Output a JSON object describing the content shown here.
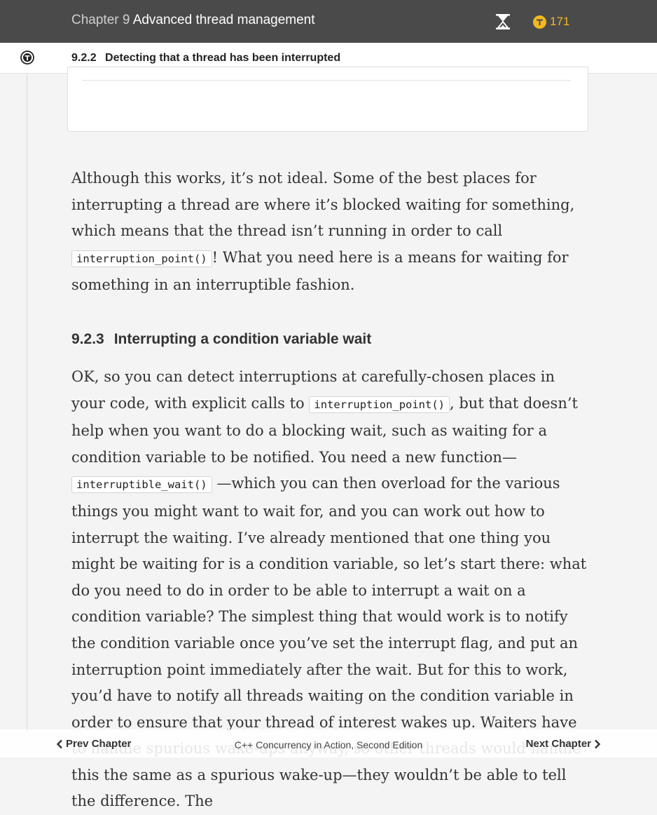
{
  "header": {
    "chapter_num": "Chapter 9",
    "chapter_title": "Advanced thread management",
    "token_count": "171"
  },
  "subheader": {
    "section_num": "9.2.2",
    "section_title": "Detecting that a thread has been interrupted"
  },
  "content": {
    "p1": {
      "t1": "Although this works, it’s not ideal. Some of the best places for interrupting a thread are where it’s blocked waiting for something, which means that the thread isn’t running in order to call ",
      "c1": "interruption_point()",
      "t2": "! What you need here is a means for waiting for something in an interruptible fashion."
    },
    "heading": {
      "num": "9.2.3",
      "title": "Interrupting a condition variable wait"
    },
    "p2": {
      "t1": "OK, so you can detect interruptions at carefully-chosen places in your code, with explicit calls to ",
      "c1": "interruption_point()",
      "t2": ", but that doesn’t help when you want to do a blocking wait, such as waiting for a condition variable to be notified. You need a new function—",
      "c2": "interruptible_wait()",
      "t3": " —which you can then overload for the various things you might want to wait for, and you can work out how to interrupt the waiting. I’ve already mentioned that one thing you might be waiting for is a condition variable, so let’s start there: what do you need to do in order to be able to interrupt a wait on a condition variable? The simplest thing that would work is to notify the condition variable once you’ve set the interrupt flag, and put an interruption point immediately after the wait. But for this to work, you’d have to notify all threads waiting on the condition variable in order to ensure that your thread of interest wakes up. Waiters have to handle spurious wake-ups anyway, so other threads would handle this the same as a spurious wake-up—they wouldn’t be able to tell the difference. The"
    }
  },
  "footer": {
    "prev_label": "Prev Chapter",
    "book_title": "C++ Concurrency in Action, Second Edition",
    "next_label": "Next Chapter"
  },
  "colors": {
    "header_bg": "#4a4a4a",
    "token_accent": "#f3b81f",
    "page_bg": "#f4f4f4"
  }
}
